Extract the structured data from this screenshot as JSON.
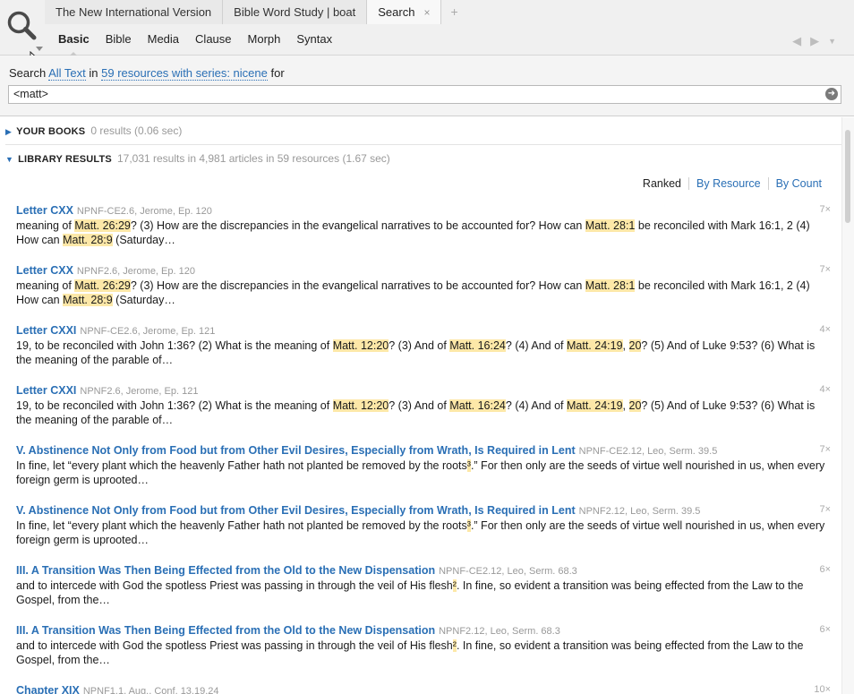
{
  "tabs": [
    {
      "label": "The New International Version",
      "active": false
    },
    {
      "label": "Bible Word Study | boat",
      "active": false
    },
    {
      "label": "Search",
      "active": true,
      "close": "×"
    }
  ],
  "tab_add": "+",
  "subnav": [
    "Basic",
    "Bible",
    "Media",
    "Clause",
    "Morph",
    "Syntax"
  ],
  "nav": {
    "back": "◀",
    "forward": "▶",
    "menu": "▼"
  },
  "search": {
    "prefix": "Search",
    "scope": "All Text",
    "in": "in",
    "resources": "59 resources with series: nicene",
    "for": "for",
    "query": "<matt>",
    "go": "➜"
  },
  "your_books": {
    "label": "YOUR BOOKS",
    "meta": "0 results (0.06 sec)"
  },
  "library": {
    "label": "LIBRARY RESULTS",
    "meta": "17,031 results in 4,981 articles in 59 resources (1.67 sec)"
  },
  "sort": [
    "Ranked",
    "By Resource",
    "By Count"
  ],
  "results": [
    {
      "title": "Letter CXX",
      "source": "NPNF-CE2.6, Jerome, Ep. 120",
      "count": "7×",
      "snippet": [
        {
          "text": "meaning of "
        },
        {
          "text": "Matt. 26:29",
          "hl": true
        },
        {
          "text": "? (3) How are the discrepancies in the evangelical narratives to be accounted for? How can "
        },
        {
          "text": "Matt. 28:1",
          "hl": true
        },
        {
          "text": " be reconciled with Mark 16:1, 2 (4) How can "
        },
        {
          "text": "Matt. 28:9",
          "hl": true
        },
        {
          "text": " (Saturday…"
        }
      ]
    },
    {
      "title": "Letter CXX",
      "source": "NPNF2.6, Jerome, Ep. 120",
      "count": "7×",
      "snippet": [
        {
          "text": "meaning of "
        },
        {
          "text": "Matt. 26:29",
          "hl": true
        },
        {
          "text": "? (3) How are the discrepancies in the evangelical narratives to be accounted for? How can "
        },
        {
          "text": "Matt. 28:1",
          "hl": true
        },
        {
          "text": " be reconciled with Mark 16:1, 2 (4) How can "
        },
        {
          "text": "Matt. 28:9",
          "hl": true
        },
        {
          "text": " (Saturday…"
        }
      ]
    },
    {
      "title": "Letter CXXI",
      "source": "NPNF-CE2.6, Jerome, Ep. 121",
      "count": "4×",
      "snippet": [
        {
          "text": "19, to be reconciled with John 1:36? (2) What is the meaning of "
        },
        {
          "text": "Matt. 12:20",
          "hl": true
        },
        {
          "text": "? (3) And of "
        },
        {
          "text": "Matt. 16:24",
          "hl": true
        },
        {
          "text": "? (4) And of "
        },
        {
          "text": "Matt. 24:19",
          "hl": true
        },
        {
          "text": ", "
        },
        {
          "text": "20",
          "hl": true
        },
        {
          "text": "? (5) And of Luke 9:53? (6) What is the meaning of the parable of…"
        }
      ]
    },
    {
      "title": "Letter CXXI",
      "source": "NPNF2.6, Jerome, Ep. 121",
      "count": "4×",
      "snippet": [
        {
          "text": "19, to be reconciled with John 1:36? (2) What is the meaning of "
        },
        {
          "text": "Matt. 12:20",
          "hl": true
        },
        {
          "text": "? (3) And of "
        },
        {
          "text": "Matt. 16:24",
          "hl": true
        },
        {
          "text": "? (4) And of "
        },
        {
          "text": "Matt. 24:19",
          "hl": true
        },
        {
          "text": ", "
        },
        {
          "text": "20",
          "hl": true
        },
        {
          "text": "? (5) And of Luke 9:53? (6) What is the meaning of the parable of…"
        }
      ]
    },
    {
      "title": "V. Abstinence Not Only from Food but from Other Evil Desires, Especially from Wrath, Is Required in Lent",
      "source": "NPNF-CE2.12, Leo, Serm. 39.5",
      "count": "7×",
      "snippet": [
        {
          "text": "In fine, let “every plant which the heavenly Father hath not planted be removed by the roots"
        },
        {
          "text": "³",
          "hl": true
        },
        {
          "text": ".” For then only are the seeds of virtue well nourished in us, when every foreign germ is uprooted…"
        }
      ]
    },
    {
      "title": "V. Abstinence Not Only from Food but from Other Evil Desires, Especially from Wrath, Is Required in Lent",
      "source": "NPNF2.12, Leo, Serm. 39.5",
      "count": "7×",
      "snippet": [
        {
          "text": "In fine, let “every plant which the heavenly Father hath not planted be removed by the roots"
        },
        {
          "text": "³",
          "hl": true
        },
        {
          "text": ".” For then only are the seeds of virtue well nourished in us, when every foreign germ is uprooted…"
        }
      ]
    },
    {
      "title": "III. A Transition Was Then Being Effected from the Old to the New Dispensation",
      "source": "NPNF-CE2.12, Leo, Serm. 68.3",
      "count": "6×",
      "snippet": [
        {
          "text": "and to intercede with God the spotless Priest was passing in through the veil of His flesh"
        },
        {
          "text": "²",
          "hl": true
        },
        {
          "text": ". In fine, so evident a transition was being effected from the Law to the Gospel, from the…"
        }
      ]
    },
    {
      "title": "III. A Transition Was Then Being Effected from the Old to the New Dispensation",
      "source": "NPNF2.12, Leo, Serm. 68.3",
      "count": "6×",
      "snippet": [
        {
          "text": "and to intercede with God the spotless Priest was passing in through the veil of His flesh"
        },
        {
          "text": "²",
          "hl": true
        },
        {
          "text": ". In fine, so evident a transition was being effected from the Law to the Gospel, from the…"
        }
      ]
    },
    {
      "title": "Chapter XIX",
      "source": "NPNF1.1, Aug., Conf. 13.19.24",
      "count": "10×",
      "snippet": []
    }
  ]
}
